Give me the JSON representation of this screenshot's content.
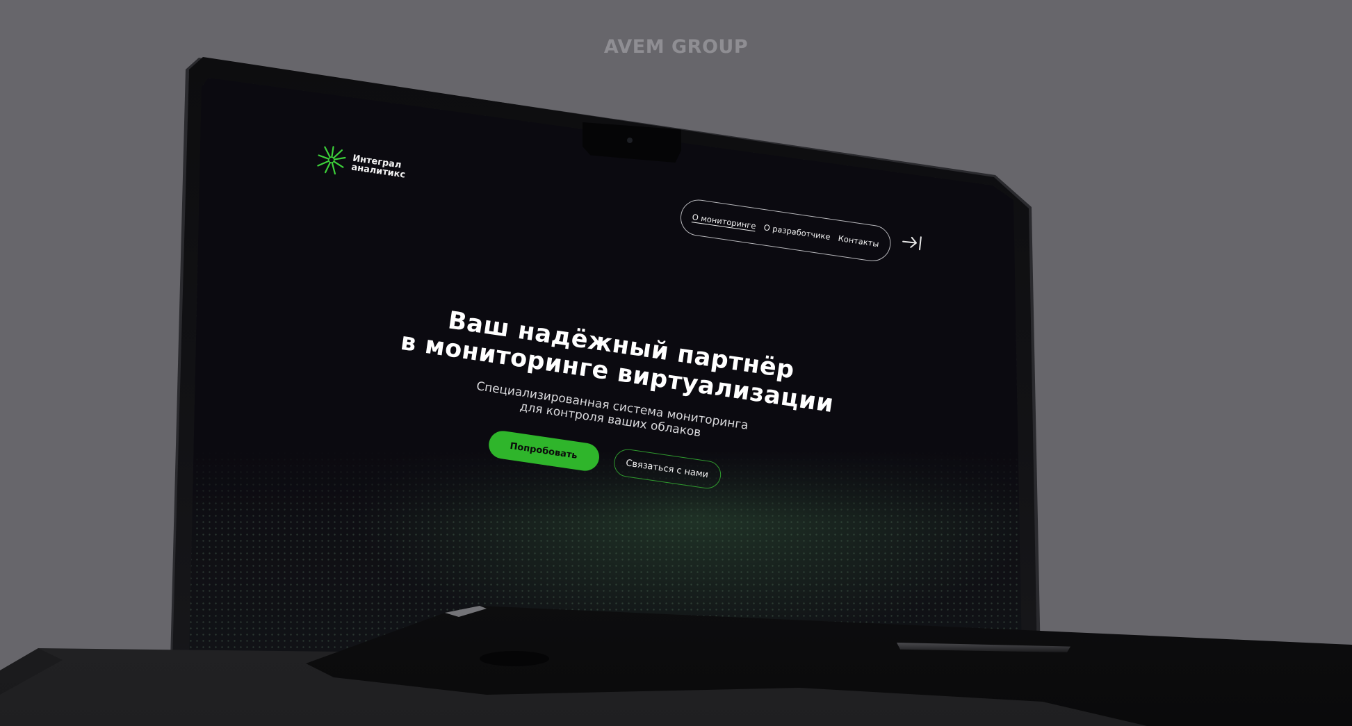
{
  "watermark": "AVEM GROUP",
  "logo": {
    "icon": "starburst-logo-icon",
    "line1": "Интеграл",
    "line2": "аналитикс",
    "color": "#3dd13a"
  },
  "nav": {
    "items": [
      {
        "label": "О мониторинге",
        "active": true
      },
      {
        "label": "О разработчике",
        "active": false
      },
      {
        "label": "Контакты",
        "active": false
      }
    ],
    "login_icon": "login-arrow-icon"
  },
  "hero": {
    "title_line1": "Ваш надёжный партнёр",
    "title_line2": "в мониторинге виртуализации",
    "subtitle_line1": "Специализированная система мониторинга",
    "subtitle_line2": "для контроля ваших облаков",
    "primary_button": "Попробовать",
    "secondary_button": "Связаться с нами"
  },
  "colors": {
    "background": "#67666b",
    "accent_green": "#2fb52b",
    "screen_bg": "#0b0a10"
  }
}
